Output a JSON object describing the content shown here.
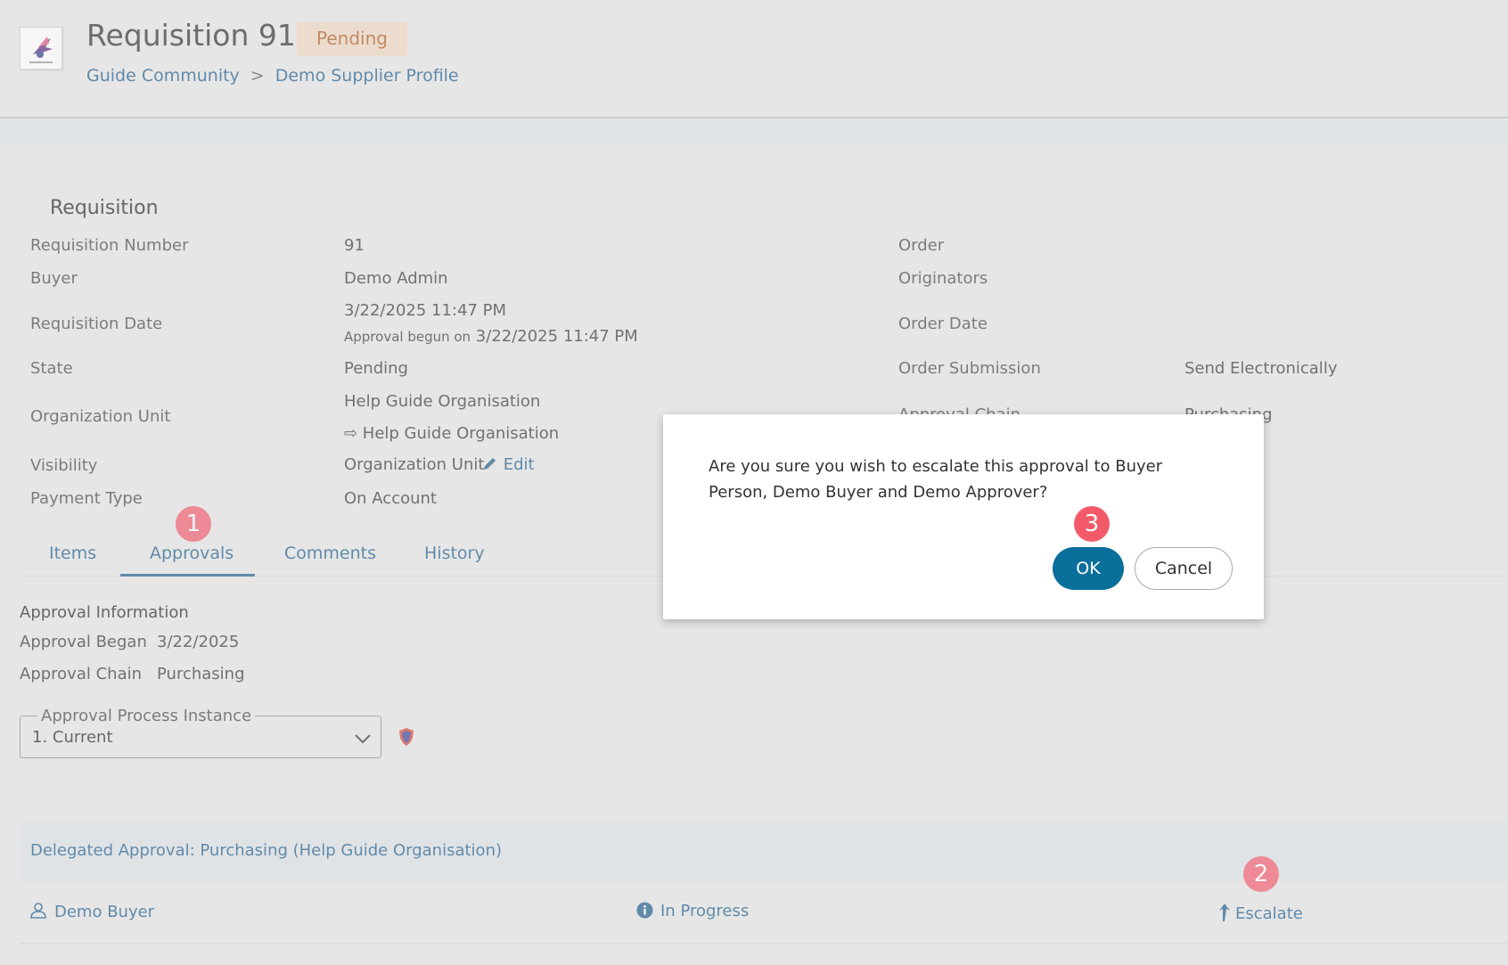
{
  "header": {
    "title": "Requisition 91",
    "status_badge": "Pending",
    "breadcrumb": [
      "Guide Community",
      "Demo Supplier Profile"
    ],
    "breadcrumb_sep": ">"
  },
  "details": {
    "section_title": "Requisition",
    "left": {
      "requisition_number_label": "Requisition Number",
      "requisition_number": "91",
      "buyer_label": "Buyer",
      "buyer": "Demo Admin",
      "requisition_date_label": "Requisition Date",
      "requisition_date": "3/22/2025 11:47 PM",
      "approval_begun_prefix": "Approval begun on",
      "approval_begun_date": "3/22/2025 11:47 PM",
      "state_label": "State",
      "state": "Pending",
      "org_unit_label": "Organization Unit",
      "org_unit": "Help Guide Organisation",
      "org_unit_sub": "⇨ Help Guide Organisation",
      "visibility_label": "Visibility",
      "visibility": "Organization Unit",
      "edit_label": "Edit",
      "payment_type_label": "Payment Type",
      "payment_type": "On Account"
    },
    "right": {
      "order_label": "Order",
      "originators_label": "Originators",
      "order_date_label": "Order Date",
      "order_submission_label": "Order Submission",
      "order_submission": "Send Electronically",
      "approval_chain_label": "Approval Chain",
      "approval_chain": "Purchasing"
    }
  },
  "tabs": [
    "Items",
    "Approvals",
    "Comments",
    "History"
  ],
  "approval_info": {
    "title": "Approval Information",
    "began_label": "Approval Began",
    "began_value": "3/22/2025",
    "chain_label": "Approval Chain",
    "chain_value": "Purchasing",
    "process_legend": "Approval Process Instance",
    "process_value": "1. Current"
  },
  "delegated": {
    "title": "Delegated Approval: Purchasing (Help Guide Organisation)",
    "person": "Demo Buyer",
    "status": "In Progress",
    "action": "Escalate"
  },
  "dialog": {
    "message": "Are you sure you wish to escalate this approval to Buyer Person, Demo Buyer and Demo Approver?",
    "ok_label": "OK",
    "cancel_label": "Cancel"
  },
  "markers": [
    "1",
    "2",
    "3"
  ],
  "colors": {
    "link": "#1a5a8a",
    "badge_bg": "#f0d8c2",
    "badge_text": "#b05a1e",
    "primary_button": "#0a6f9a",
    "marker": "#f25a6a"
  },
  "icons": {
    "org_logo": "org-logo-icon",
    "edit": "pencil-icon",
    "select": "chevron-down-icon",
    "shield": "shield-icon",
    "person": "user-icon",
    "status": "info-icon",
    "escalate": "arrow-up-icon"
  }
}
